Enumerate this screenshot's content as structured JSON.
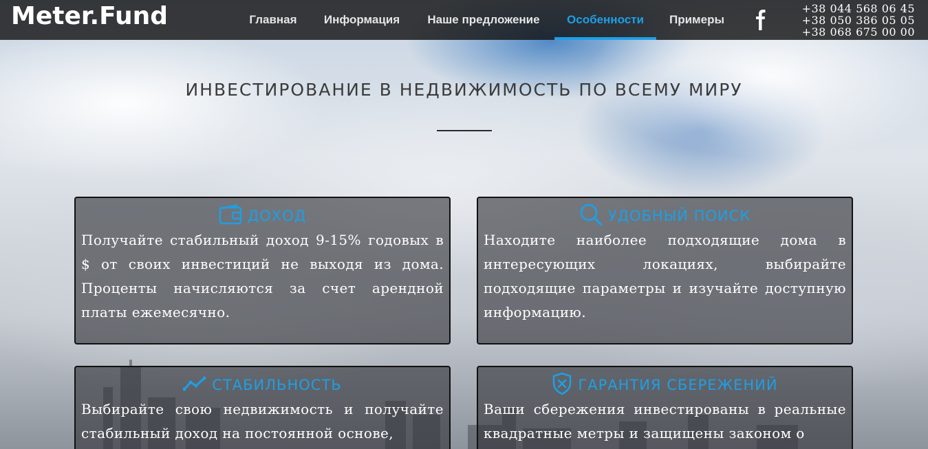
{
  "header": {
    "logo": "Meter.Fund",
    "nav": [
      {
        "label": "Главная",
        "active": false
      },
      {
        "label": "Информация",
        "active": false
      },
      {
        "label": "Наше предложение",
        "active": false
      },
      {
        "label": "Особенности",
        "active": true
      },
      {
        "label": "Примеры",
        "active": false
      }
    ],
    "social_icon": "facebook-icon",
    "phones": [
      "+38 044 568 06 45",
      "+38 050 386 05 05",
      "+38 068 675 00 00"
    ]
  },
  "main": {
    "title": "ИНВЕСТИРОВАНИЕ В НЕДВИЖИМОСТЬ ПО ВСЕМУ МИРУ",
    "features": [
      {
        "icon": "wallet-icon",
        "title": "ДОХОД",
        "text": "Получайте стабильный доход 9-15% годовых в $ от своих инвестиций не выходя из дома. Проценты начисляются за счет арендной платы ежемесячно."
      },
      {
        "icon": "search-icon",
        "title": "УДОБНЫЙ ПОИСК",
        "text": "Находите наиболее подходящие дома в интересующих локациях, выбирайте подходящие параметры и изучайте доступную информацию."
      },
      {
        "icon": "trend-up-icon",
        "title": "СТАБИЛЬНОСТЬ",
        "text": "Выбирайте свою недвижимость и получайте стабильный доход на постоянной основе,"
      },
      {
        "icon": "shield-icon",
        "title": "ГАРАНТИЯ СБЕРЕЖЕНИЙ",
        "text": "Ваши сбережения инвестированы в реальные квадратные метры и защищены законом о"
      }
    ]
  },
  "colors": {
    "accent": "#1e9fe6",
    "navbar": "#141414",
    "card_bg": "#323438",
    "title_text": "#3b3b3b"
  }
}
